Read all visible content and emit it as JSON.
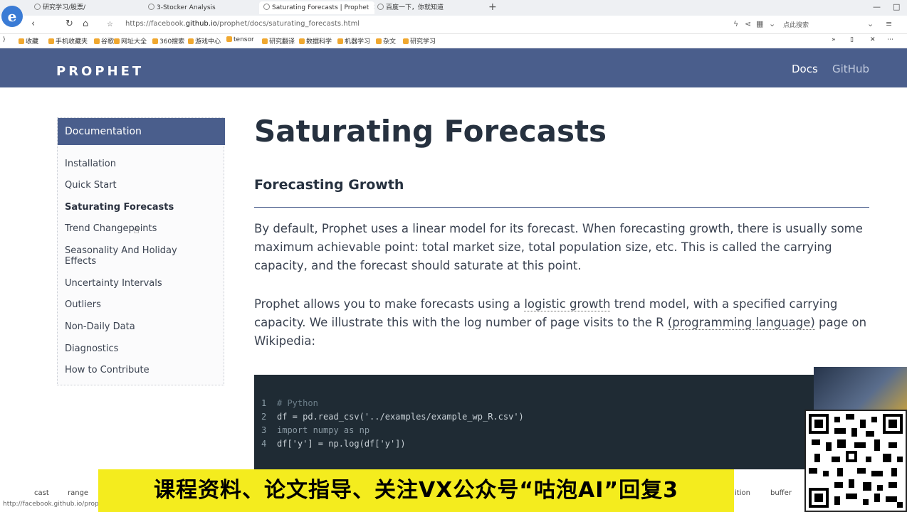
{
  "browser": {
    "tabs": [
      {
        "label": "研究学习/股票/"
      },
      {
        "label": "3-Stocker Analysis"
      },
      {
        "label": "Saturating Forecasts | Prophet"
      },
      {
        "label": "百度一下，你就知道"
      }
    ],
    "new_tab": "+",
    "url_prefix": "https://facebook.",
    "url_host": "github.io",
    "url_path": "/prophet/docs/saturating_forecasts.html",
    "search_placeholder": "点此搜索",
    "bookmarks": [
      "收藏",
      "手机收藏夹",
      "谷歌",
      "网址大全",
      "360搜索",
      "游戏中心",
      "tensor",
      "研究翻译",
      "数据科学",
      "机器学习",
      "杂文",
      "研究学习"
    ]
  },
  "site": {
    "logo": "PROPHET",
    "nav": {
      "docs": "Docs",
      "github": "GitHub"
    }
  },
  "sidebar": {
    "heading": "Documentation",
    "items": [
      {
        "label": "Installation"
      },
      {
        "label": "Quick Start"
      },
      {
        "label": "Saturating Forecasts"
      },
      {
        "label": "Trend Changepoints"
      },
      {
        "label": "Seasonality And Holiday Effects"
      },
      {
        "label": "Uncertainty Intervals"
      },
      {
        "label": "Outliers"
      },
      {
        "label": "Non-Daily Data"
      },
      {
        "label": "Diagnostics"
      },
      {
        "label": "How to Contribute"
      }
    ],
    "active_index": 2
  },
  "main": {
    "title": "Saturating Forecasts",
    "section_title": "Forecasting Growth",
    "para1": "By default, Prophet uses a linear model for its forecast. When forecasting growth, there is usually some maximum achievable point: total market size, total population size, etc. This is called the carrying capacity, and the forecast should saturate at this point.",
    "para2_a": "Prophet allows you to make forecasts using a ",
    "para2_link1": "logistic growth",
    "para2_b": " trend model, with a specified carrying capacity. We illustrate this with the log number of page visits to the R ",
    "para2_link2": "(programming language)",
    "para2_c": " page on Wikipedia:"
  },
  "code": {
    "lines": [
      {
        "n": "1",
        "text": "# Python"
      },
      {
        "n": "2",
        "text": "df = pd.read_csv('../examples/example_wp_R.csv')"
      },
      {
        "n": "3",
        "text": "import numpy as np"
      },
      {
        "n": "4",
        "text": "df['y'] = np.log(df['y'])"
      }
    ]
  },
  "overlay": {
    "banner": "课程资料、论文指导、关注VX公众号“咕泡AI”回复3"
  },
  "status": {
    "url": "http://facebook.github.io/prophet/...",
    "words": [
      "cast",
      "range",
      "ition",
      "buffer"
    ]
  }
}
